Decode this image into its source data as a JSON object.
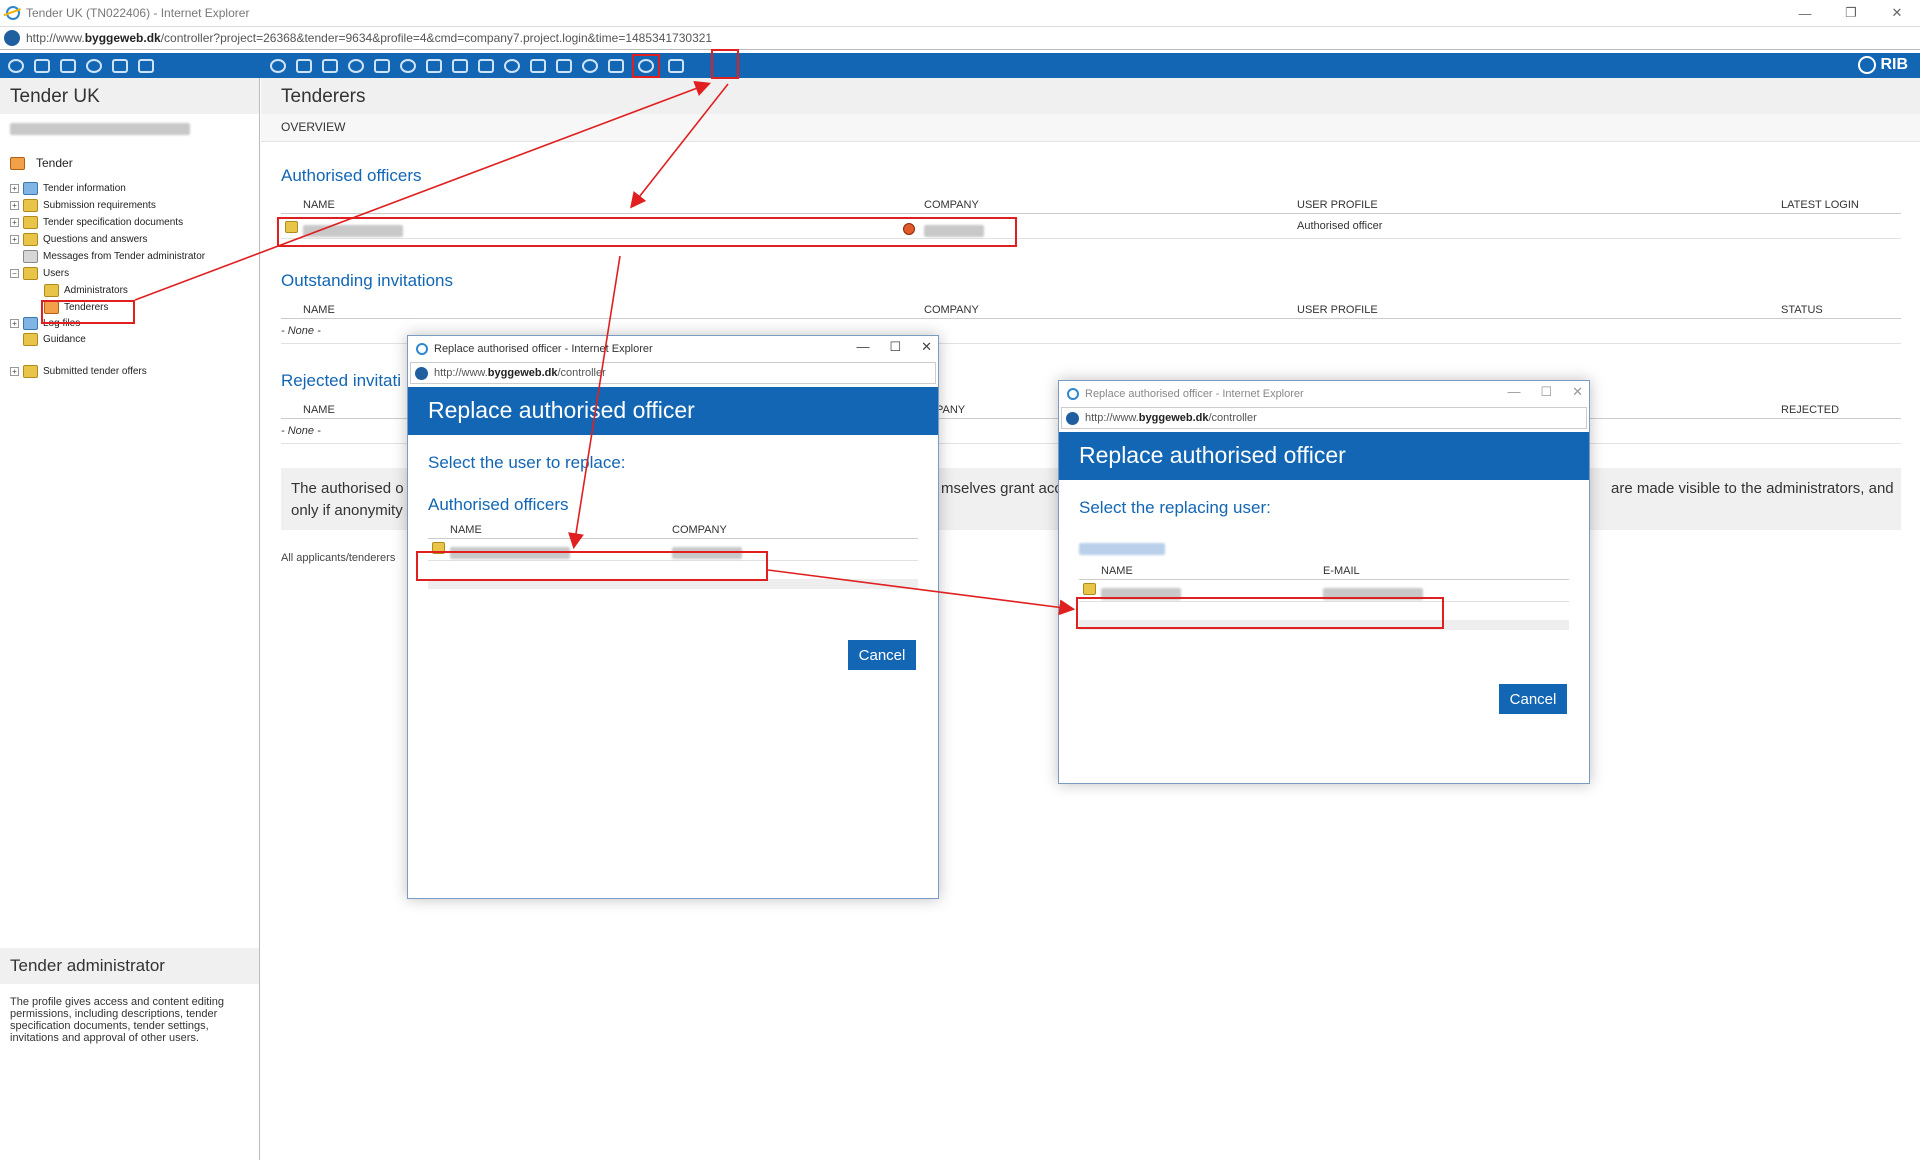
{
  "window": {
    "title": "Tender UK (TN022406) - Internet Explorer",
    "url_prefix": "http://www.",
    "url_domain": "byggeweb.dk",
    "url_rest": "/controller?project=26368&tender=9634&profile=4&cmd=company7.project.login&time=1485341730321",
    "minimize": "—",
    "restore": "❐",
    "close": "✕"
  },
  "toolbar": {
    "brand": "RIB"
  },
  "left_panel": {
    "title": "Tender UK",
    "tree_root": "Tender",
    "tree": [
      {
        "label": "Tender information"
      },
      {
        "label": "Submission requirements"
      },
      {
        "label": "Tender specification documents"
      },
      {
        "label": "Questions and answers"
      },
      {
        "label": "Messages from Tender administrator"
      },
      {
        "label": "Users"
      },
      {
        "label": "Administrators"
      },
      {
        "label": "Tenderers"
      },
      {
        "label": "Log files"
      },
      {
        "label": "Guidance"
      },
      {
        "label": "Submitted tender offers"
      }
    ],
    "bottom_title": "Tender administrator",
    "bottom_desc": "The profile gives access and content editing permissions, including descriptions, tender specification documents, tender settings, invitations and approval of other users."
  },
  "main": {
    "title": "Tenderers",
    "subtitle": "OVERVIEW",
    "authorised": {
      "title": "Authorised officers",
      "cols": [
        "NAME",
        "COMPANY",
        "USER PROFILE",
        "LATEST LOGIN"
      ],
      "row_profile": "Authorised officer"
    },
    "outstanding": {
      "title": "Outstanding invitations",
      "cols": [
        "NAME",
        "COMPANY",
        "USER PROFILE",
        "STATUS"
      ],
      "none": "- None -"
    },
    "rejected": {
      "title": "Rejected invitati",
      "cols": [
        "NAME",
        "COMPANY",
        "REJECTED"
      ],
      "company_partial": "PANY",
      "none": "- None -"
    },
    "info_left_1": "The authorised o",
    "info_left_2": "only if anonymity",
    "info_mid": "mselves grant acc",
    "info_right": "are made visible to the administrators, and",
    "all_applicants": "All applicants/tenderers"
  },
  "dialog1": {
    "title": "Replace authorised officer - Internet Explorer",
    "url_prefix": "http://www.",
    "url_domain": "byggeweb.dk",
    "url_rest": "/controller",
    "banner": "Replace authorised officer",
    "prompt": "Select the user to replace:",
    "section": "Authorised officers",
    "cols": [
      "NAME",
      "COMPANY"
    ],
    "cancel": "Cancel",
    "min": "—",
    "max": "☐",
    "close": "✕"
  },
  "dialog2": {
    "title": "Replace authorised officer - Internet Explorer",
    "url_prefix": "http://www.",
    "url_domain": "byggeweb.dk",
    "url_rest": "/controller",
    "banner": "Replace authorised officer",
    "prompt": "Select the replacing user:",
    "cols": [
      "NAME",
      "E-MAIL"
    ],
    "cancel": "Cancel",
    "min": "—",
    "max": "☐",
    "close": "✕"
  },
  "colors": {
    "accent": "#1266b4",
    "highlight": "#e02020",
    "panel": "#f0f0f0"
  }
}
